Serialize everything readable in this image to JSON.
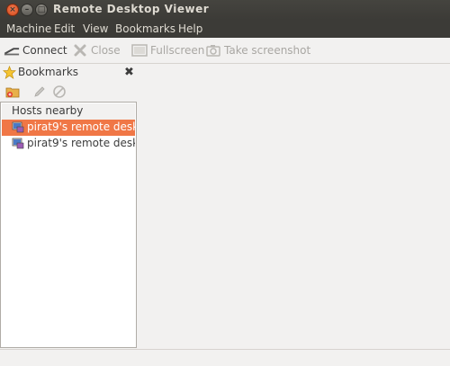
{
  "window": {
    "title": "Remote Desktop Viewer"
  },
  "menu": [
    "Machine",
    "Edit",
    "View",
    "Bookmarks",
    "Help"
  ],
  "toolbar": {
    "connect": "Connect",
    "close": "Close",
    "fullscreen": "Fullscreen",
    "screenshot": "Take screenshot"
  },
  "sidepane": {
    "title": "Bookmarks",
    "tree_header": "Hosts nearby",
    "items": [
      {
        "label": "pirat9's remote desk...",
        "selected": true
      },
      {
        "label": "pirat9's remote desk...",
        "selected": false
      }
    ]
  },
  "colors": {
    "accent": "#f07746",
    "titlebar": "#3c3b37"
  }
}
